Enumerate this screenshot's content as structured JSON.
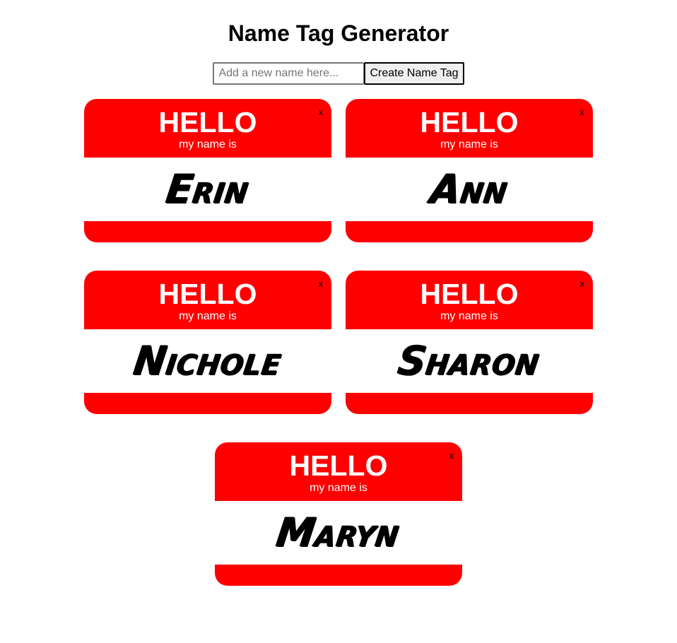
{
  "header": {
    "title": "Name Tag Generator"
  },
  "form": {
    "input_value": "",
    "input_placeholder": "Add a new name here...",
    "button_label": "Create Name Tag"
  },
  "tag_template": {
    "hello": "HELLO",
    "subtitle": "my name is",
    "close_label": "x"
  },
  "tags": [
    {
      "name": "Erin"
    },
    {
      "name": "Ann"
    },
    {
      "name": "Nichole"
    },
    {
      "name": "Sharon"
    },
    {
      "name": "Maryn"
    }
  ],
  "colors": {
    "tag_red": "#ff0000",
    "tag_text": "#ffffff",
    "name_text": "#000000"
  }
}
